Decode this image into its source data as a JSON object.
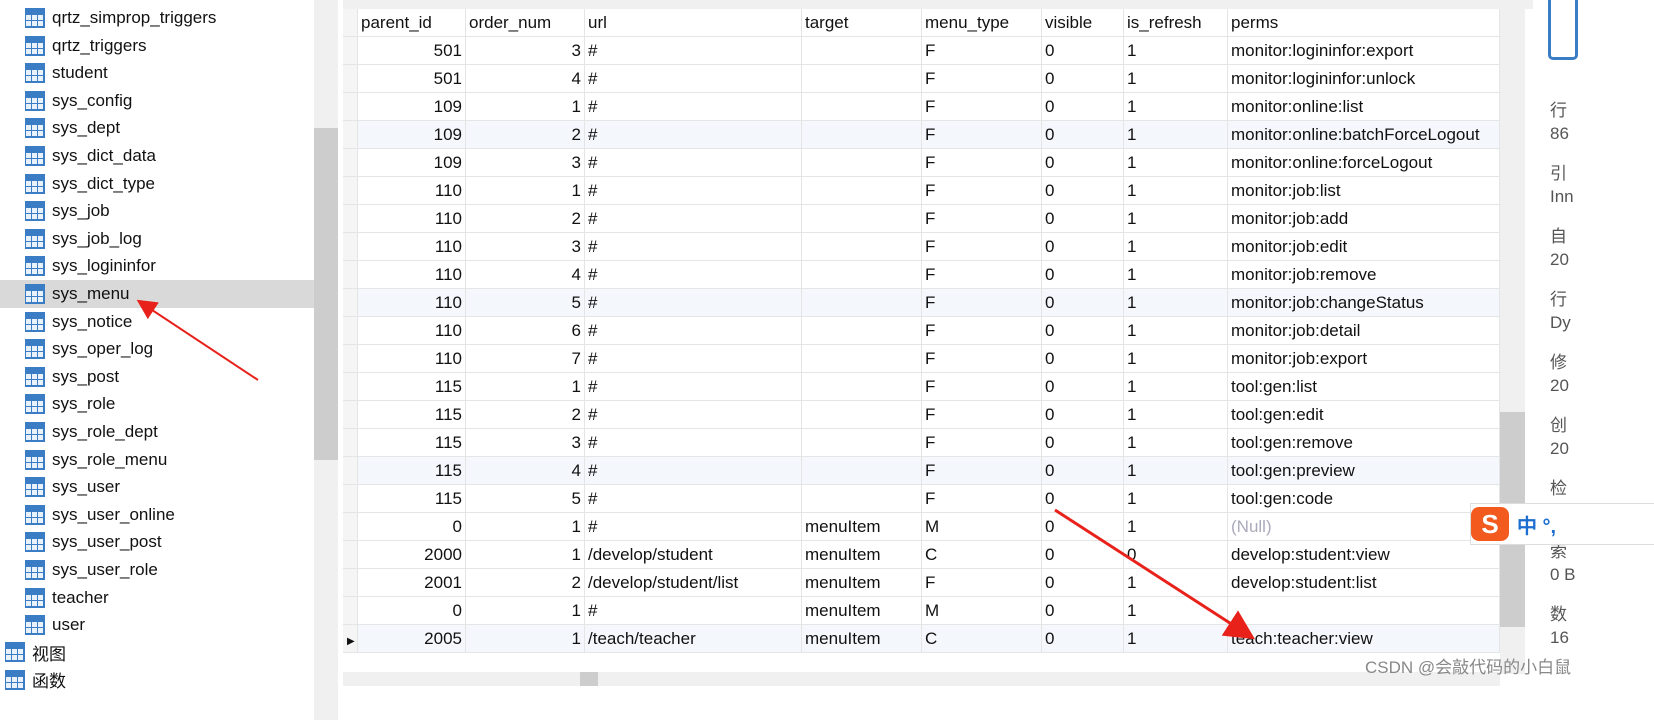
{
  "sidebar": {
    "tables": [
      "qrtz_simprop_triggers",
      "qrtz_triggers",
      "student",
      "sys_config",
      "sys_dept",
      "sys_dict_data",
      "sys_dict_type",
      "sys_job",
      "sys_job_log",
      "sys_logininfor",
      "sys_menu",
      "sys_notice",
      "sys_oper_log",
      "sys_post",
      "sys_role",
      "sys_role_dept",
      "sys_role_menu",
      "sys_user",
      "sys_user_online",
      "sys_user_post",
      "sys_user_role",
      "teacher",
      "user"
    ],
    "selected": "sys_menu",
    "views_label": "视图",
    "functions_label": "函数"
  },
  "grid": {
    "columns": [
      "parent_id",
      "order_num",
      "url",
      "target",
      "menu_type",
      "visible",
      "is_refresh",
      "perms"
    ],
    "rows": [
      [
        "501",
        "3",
        "#",
        "",
        "F",
        "0",
        "1",
        "monitor:logininfor:export"
      ],
      [
        "501",
        "4",
        "#",
        "",
        "F",
        "0",
        "1",
        "monitor:logininfor:unlock"
      ],
      [
        "109",
        "1",
        "#",
        "",
        "F",
        "0",
        "1",
        "monitor:online:list"
      ],
      [
        "109",
        "2",
        "#",
        "",
        "F",
        "0",
        "1",
        "monitor:online:batchForceLogout"
      ],
      [
        "109",
        "3",
        "#",
        "",
        "F",
        "0",
        "1",
        "monitor:online:forceLogout"
      ],
      [
        "110",
        "1",
        "#",
        "",
        "F",
        "0",
        "1",
        "monitor:job:list"
      ],
      [
        "110",
        "2",
        "#",
        "",
        "F",
        "0",
        "1",
        "monitor:job:add"
      ],
      [
        "110",
        "3",
        "#",
        "",
        "F",
        "0",
        "1",
        "monitor:job:edit"
      ],
      [
        "110",
        "4",
        "#",
        "",
        "F",
        "0",
        "1",
        "monitor:job:remove"
      ],
      [
        "110",
        "5",
        "#",
        "",
        "F",
        "0",
        "1",
        "monitor:job:changeStatus"
      ],
      [
        "110",
        "6",
        "#",
        "",
        "F",
        "0",
        "1",
        "monitor:job:detail"
      ],
      [
        "110",
        "7",
        "#",
        "",
        "F",
        "0",
        "1",
        "monitor:job:export"
      ],
      [
        "115",
        "1",
        "#",
        "",
        "F",
        "0",
        "1",
        "tool:gen:list"
      ],
      [
        "115",
        "2",
        "#",
        "",
        "F",
        "0",
        "1",
        "tool:gen:edit"
      ],
      [
        "115",
        "3",
        "#",
        "",
        "F",
        "0",
        "1",
        "tool:gen:remove"
      ],
      [
        "115",
        "4",
        "#",
        "",
        "F",
        "0",
        "1",
        "tool:gen:preview"
      ],
      [
        "115",
        "5",
        "#",
        "",
        "F",
        "0",
        "1",
        "tool:gen:code"
      ],
      [
        "0",
        "1",
        "#",
        "menuItem",
        "M",
        "0",
        "1",
        "(Null)"
      ],
      [
        "2000",
        "1",
        "/develop/student",
        "menuItem",
        "C",
        "0",
        "0",
        "develop:student:view"
      ],
      [
        "2001",
        "2",
        "/develop/student/list",
        "menuItem",
        "F",
        "0",
        "1",
        "develop:student:list"
      ],
      [
        "0",
        "1",
        "#",
        "menuItem",
        "M",
        "0",
        "1",
        ""
      ],
      [
        "2005",
        "1",
        "/teach/teacher",
        "menuItem",
        "C",
        "0",
        "1",
        "teach:teacher:view"
      ]
    ]
  },
  "right_panel": {
    "labels": [
      "行",
      "86",
      "引",
      "Inn",
      "自",
      "20",
      "行",
      "Dy",
      "修",
      "20",
      "创",
      "20",
      "检",
      "",
      "索",
      "0 B",
      "数",
      "16"
    ]
  },
  "ime": {
    "logo": "S",
    "text": "中 °,"
  },
  "watermark": "CSDN @会敲代码的小白鼠",
  "colors": {
    "selected_row": "#d9d9d9",
    "alt_row": "#f4f8fd",
    "arrow": "#e8221b",
    "table_icon": "#3b7dc4"
  }
}
